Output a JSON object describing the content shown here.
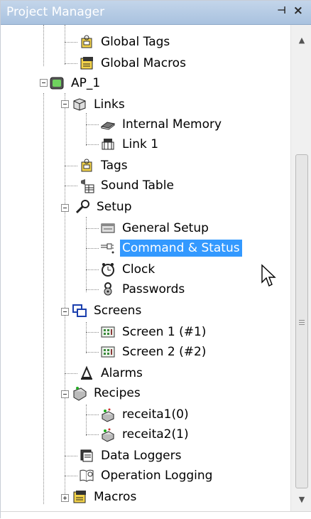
{
  "panel": {
    "title": "Project Manager",
    "pin_glyph": "⊣",
    "close_glyph": "×"
  },
  "tree": [
    {
      "id": "global-tags",
      "label": "Global Tags",
      "icon": "tag-icon"
    },
    {
      "id": "global-macros",
      "label": "Global Macros",
      "icon": "macro-icon"
    },
    {
      "id": "ap1",
      "label": "AP_1",
      "icon": "device-icon",
      "expanded": true
    },
    {
      "id": "links",
      "label": "Links",
      "icon": "links-icon",
      "expanded": true
    },
    {
      "id": "internal-memory",
      "label": "Internal Memory",
      "icon": "memory-chip-icon"
    },
    {
      "id": "link1",
      "label": "Link 1",
      "icon": "network-link-icon"
    },
    {
      "id": "tags",
      "label": "Tags",
      "icon": "tag-icon"
    },
    {
      "id": "sound-table",
      "label": "Sound Table",
      "icon": "sound-table-icon"
    },
    {
      "id": "setup",
      "label": "Setup",
      "icon": "wrench-icon",
      "expanded": true
    },
    {
      "id": "general-setup",
      "label": "General Setup",
      "icon": "general-setup-icon"
    },
    {
      "id": "command-status",
      "label": "Command & Status",
      "icon": "command-status-icon",
      "selected": true
    },
    {
      "id": "clock",
      "label": "Clock",
      "icon": "clock-icon"
    },
    {
      "id": "passwords",
      "label": "Passwords",
      "icon": "password-icon"
    },
    {
      "id": "screens",
      "label": "Screens",
      "icon": "screens-icon",
      "expanded": true
    },
    {
      "id": "screen1",
      "label": "Screen 1 (#1)",
      "icon": "screen-icon"
    },
    {
      "id": "screen2",
      "label": "Screen 2 (#2)",
      "icon": "screen-icon"
    },
    {
      "id": "alarms",
      "label": "Alarms",
      "icon": "alarm-bell-icon"
    },
    {
      "id": "recipes",
      "label": "Recipes",
      "icon": "recipes-icon",
      "expanded": true
    },
    {
      "id": "receita1",
      "label": "receita1(0)",
      "icon": "recipe-icon"
    },
    {
      "id": "receita2",
      "label": "receita2(1)",
      "icon": "recipe-icon"
    },
    {
      "id": "data-loggers",
      "label": "Data Loggers",
      "icon": "data-logger-icon"
    },
    {
      "id": "operation-logging",
      "label": "Operation Logging",
      "icon": "operation-log-icon"
    },
    {
      "id": "macros",
      "label": "Macros",
      "icon": "macro-icon",
      "expanded": false
    }
  ],
  "scrollbar": {
    "up_glyph": "▲",
    "down_glyph": "▼"
  },
  "colors": {
    "selection": "#3399ff",
    "title_bar": "#b8cde6",
    "title_text": "#ffffff"
  }
}
